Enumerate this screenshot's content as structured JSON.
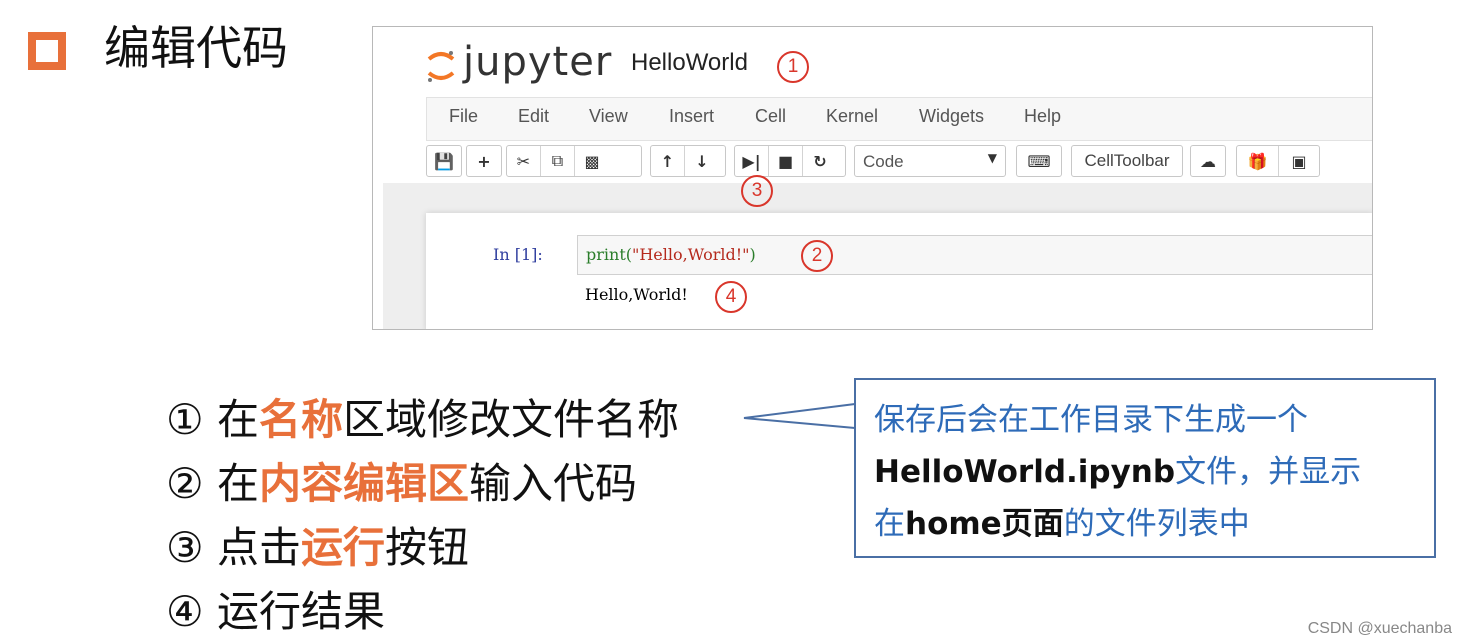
{
  "slide": {
    "title": "编辑代码",
    "accent_color": "#e8703a",
    "credit": "CSDN @xuechanba"
  },
  "notebook": {
    "logo_text": "jupyter",
    "name": "HelloWorld",
    "menu": [
      "File",
      "Edit",
      "View",
      "Insert",
      "Cell",
      "Kernel",
      "Widgets",
      "Help"
    ],
    "toolbar": {
      "icons": [
        "save-icon",
        "plus-icon",
        "cut-icon",
        "copy-icon",
        "paste-icon",
        "arrow-up-icon",
        "arrow-down-icon",
        "run-icon",
        "stop-icon",
        "restart-icon",
        "keyboard-icon",
        "cloud-upload-icon",
        "gift-icon",
        "presentation-icon"
      ],
      "cell_type": "Code",
      "celltoolbar_label": "CellToolbar"
    },
    "cell": {
      "prompt": "In  [1]:",
      "code_func": "print(",
      "code_str": "\"Hello,World!\"",
      "code_end": ")",
      "output": "Hello,World!"
    },
    "markers": [
      "1",
      "2",
      "3",
      "4"
    ]
  },
  "list": [
    {
      "num": "①",
      "pre": "在",
      "hl": "名称",
      "post": "区域修改文件名称"
    },
    {
      "num": "②",
      "pre": "在",
      "hl": "内容编辑区",
      "post": "输入代码"
    },
    {
      "num": "③",
      "pre": "点击",
      "hl": "运行",
      "post": "按钮"
    },
    {
      "num": "④",
      "pre": "运行结果",
      "hl": "",
      "post": ""
    }
  ],
  "callout": {
    "line1": "保存后会在工作目录下生成一个",
    "filename": "HelloWorld.ipynb",
    "line2_post": "文件，并显示",
    "line3_pre": "在",
    "home": "home页面",
    "line3_post": "的文件列表中"
  }
}
